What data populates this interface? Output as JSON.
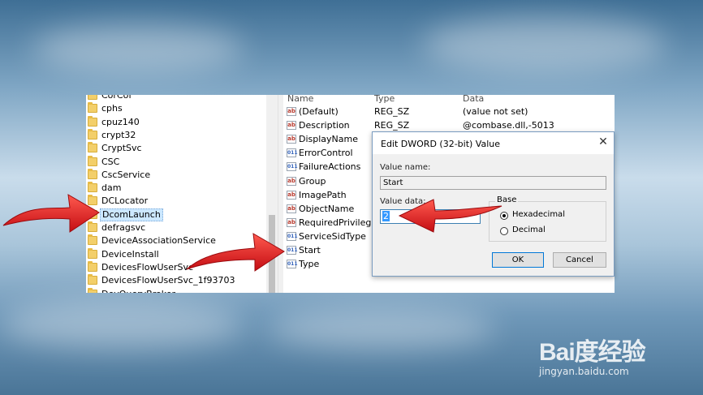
{
  "tree": {
    "items": [
      {
        "label": "CorCof",
        "selected": false
      },
      {
        "label": "cphs",
        "selected": false
      },
      {
        "label": "cpuz140",
        "selected": false
      },
      {
        "label": "crypt32",
        "selected": false
      },
      {
        "label": "CryptSvc",
        "selected": false
      },
      {
        "label": "CSC",
        "selected": false
      },
      {
        "label": "CscService",
        "selected": false
      },
      {
        "label": "dam",
        "selected": false
      },
      {
        "label": "DCLocator",
        "selected": false
      },
      {
        "label": "DcomLaunch",
        "selected": true
      },
      {
        "label": "defragsvc",
        "selected": false
      },
      {
        "label": "DeviceAssociationService",
        "selected": false
      },
      {
        "label": "DeviceInstall",
        "selected": false
      },
      {
        "label": "DevicesFlowUserSvc",
        "selected": false
      },
      {
        "label": "DevicesFlowUserSvc_1f93703",
        "selected": false
      },
      {
        "label": "DevQueryBroker",
        "selected": false
      }
    ]
  },
  "list": {
    "headers": {
      "name": "Name",
      "type": "Type",
      "data": "Data"
    },
    "rows": [
      {
        "name": "(Default)",
        "type": "REG_SZ",
        "data": "(value not set)",
        "icon": "string-value-icon"
      },
      {
        "name": "Description",
        "type": "REG_SZ",
        "data": "@combase.dll,-5013",
        "icon": "string-value-icon"
      },
      {
        "name": "DisplayName",
        "type": "",
        "data": "",
        "icon": "string-value-icon"
      },
      {
        "name": "ErrorControl",
        "type": "",
        "data": "",
        "icon": "binary-value-icon"
      },
      {
        "name": "FailureActions",
        "type": "",
        "data": "",
        "icon": "binary-value-icon"
      },
      {
        "name": "Group",
        "type": "",
        "data": "",
        "icon": "string-value-icon"
      },
      {
        "name": "ImagePath",
        "type": "",
        "data": "",
        "icon": "string-value-icon"
      },
      {
        "name": "ObjectName",
        "type": "",
        "data": "",
        "icon": "string-value-icon"
      },
      {
        "name": "RequiredPrivileg...",
        "type": "",
        "data": "",
        "icon": "string-value-icon"
      },
      {
        "name": "ServiceSidType",
        "type": "",
        "data": "",
        "icon": "binary-value-icon"
      },
      {
        "name": "Start",
        "type": "",
        "data": "",
        "icon": "binary-value-icon"
      },
      {
        "name": "Type",
        "type": "",
        "data": "",
        "icon": "binary-value-icon"
      }
    ]
  },
  "dialog": {
    "title": "Edit DWORD (32-bit) Value",
    "close_glyph": "✕",
    "value_name_label": "Value name:",
    "value_name": "Start",
    "value_data_label": "Value data:",
    "value_data": "2",
    "base_label": "Base",
    "hex_label": "Hexadecimal",
    "dec_label": "Decimal",
    "selected_base": "Hexadecimal",
    "ok_label": "OK",
    "cancel_label": "Cancel"
  },
  "icon_glyphs": {
    "string": "ab",
    "binary": "011"
  },
  "watermark": {
    "logo": "Bai度经验",
    "url": "jingyan.baidu.com"
  },
  "colors": {
    "arrow": "#e5161c",
    "selection": "#cce8ff",
    "accent": "#0078d7"
  }
}
